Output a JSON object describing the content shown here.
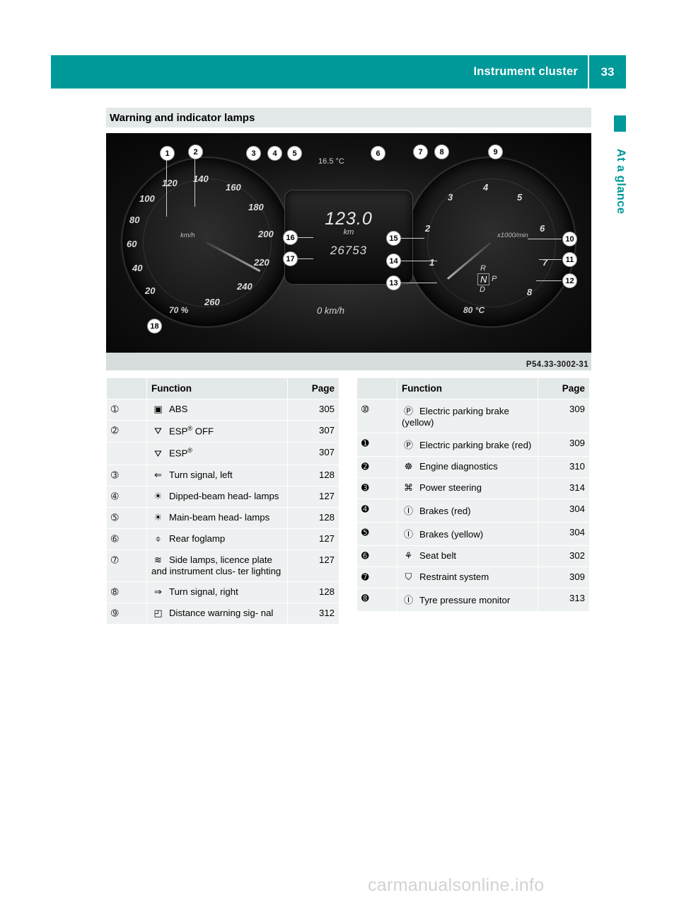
{
  "header": {
    "title": "Instrument cluster",
    "page_number": "33"
  },
  "side_tab": {
    "label": "At a glance"
  },
  "section": {
    "title": "Warning and indicator lamps"
  },
  "figure": {
    "caption": "P54.33-3002-31",
    "display": {
      "speed": "123.0",
      "speed_unit": "km",
      "odometer": "26753",
      "bottom_speed": "0 km/h",
      "temperature": "16.5 °C",
      "fuel_percent": "70 %",
      "coolant_temp": "80 °C",
      "left_unit": "km/h",
      "right_unit": "x1000/min"
    },
    "left_dial_numbers": [
      "20",
      "40",
      "60",
      "80",
      "100",
      "120",
      "140",
      "160",
      "180",
      "200",
      "220",
      "240",
      "260"
    ],
    "right_dial_numbers": [
      "1",
      "2",
      "3",
      "4",
      "5",
      "6",
      "7",
      "8"
    ],
    "gear_display": [
      "R",
      "N",
      "P",
      "D"
    ],
    "callouts": [
      "1",
      "2",
      "3",
      "4",
      "5",
      "6",
      "7",
      "8",
      "9",
      "10",
      "11",
      "12",
      "13",
      "14",
      "15",
      "16",
      "17",
      "18"
    ]
  },
  "table_headers": {
    "function": "Function",
    "page": "Page"
  },
  "rows_left": [
    {
      "marker": "\u0001",
      "symbol": "⬜",
      "icon_name": "abs-icon",
      "text": "ABS",
      "page": "305"
    },
    {
      "marker": "\u0002",
      "symbol": "⚠",
      "icon_name": "esp-off-icon",
      "text": "ESP",
      "text_sup": "®",
      "text_tail": " OFF",
      "page": "307"
    },
    {
      "marker": "",
      "symbol": "⚠",
      "icon_name": "esp-icon",
      "text": "ESP",
      "text_sup": "®",
      "text_tail": "",
      "page": "307"
    },
    {
      "marker": "\u0003",
      "symbol": "⇐",
      "icon_name": "turn-signal-left-icon",
      "text": "Turn signal, left",
      "page": "128"
    },
    {
      "marker": "\u0004",
      "symbol": "☀",
      "icon_name": "dipped-beam-headlamps-icon",
      "text": "Dipped-beam head-\nlamps",
      "page": "127"
    },
    {
      "marker": "\u0005",
      "symbol": "☀",
      "icon_name": "main-beam-headlamps-icon",
      "text": "Main-beam head-\nlamps",
      "page": "128"
    },
    {
      "marker": "\u0006",
      "symbol": "☀",
      "icon_name": "rear-foglamp-icon",
      "text": "Rear foglamp",
      "page": "127"
    },
    {
      "marker": "\u0007",
      "symbol": "☀",
      "icon_name": "side-lamps-icon",
      "text": "Side lamps, licence\nplate and instrument clus-\nter lighting",
      "page": "127"
    },
    {
      "marker": "\b",
      "symbol": "⇒",
      "icon_name": "turn-signal-right-icon",
      "text": "Turn signal, right",
      "page": "128"
    },
    {
      "marker": "\t",
      "symbol": "▲",
      "icon_name": "distance-warning-icon",
      "text": "Distance warning sig-\nnal",
      "page": "312"
    }
  ],
  "rows_right": [
    {
      "marker": "\n",
      "symbol": "P",
      "icon_name": "electric-parking-brake-yellow-icon",
      "text": "Electric parking brake\n(yellow)",
      "page": "309"
    },
    {
      "marker": "\u000b",
      "symbol": "P",
      "icon_name": "electric-parking-brake-red-icon",
      "text": "Electric parking brake\n(red)",
      "page": "309"
    },
    {
      "marker": "\f",
      "symbol": "⚙",
      "icon_name": "engine-diagnostics-icon",
      "text": "Engine diagnostics",
      "page": "310"
    },
    {
      "marker": "\r",
      "symbol": "⚡",
      "icon_name": "power-steering-icon",
      "text": "Power steering",
      "page": "314"
    },
    {
      "marker": "\u000e",
      "symbol": "Ⓘ",
      "icon_name": "brakes-red-icon",
      "text": "Brakes (red)",
      "page": "304"
    },
    {
      "marker": "\u000f",
      "symbol": "Ⓘ",
      "icon_name": "brakes-yellow-icon",
      "text": "Brakes (yellow)",
      "page": "304"
    },
    {
      "marker": "\u0010",
      "symbol": "⨁",
      "icon_name": "seat-belt-icon",
      "text": "Seat belt",
      "page": "302"
    },
    {
      "marker": "\u0011",
      "symbol": "☺",
      "icon_name": "restraint-system-icon",
      "text": "Restraint system",
      "page": "309"
    },
    {
      "marker": "\u0012",
      "symbol": "Ⓘ",
      "icon_name": "tyre-pressure-monitor-icon",
      "text": "Tyre pressure monitor",
      "page": "313"
    }
  ],
  "watermark": {
    "text": "carmanualsonline.info"
  },
  "colors": {
    "accent": "#009999",
    "header_text": "#ffffff",
    "table_bg": "#eef1f1",
    "table_header_bg": "#e3e8e8"
  }
}
